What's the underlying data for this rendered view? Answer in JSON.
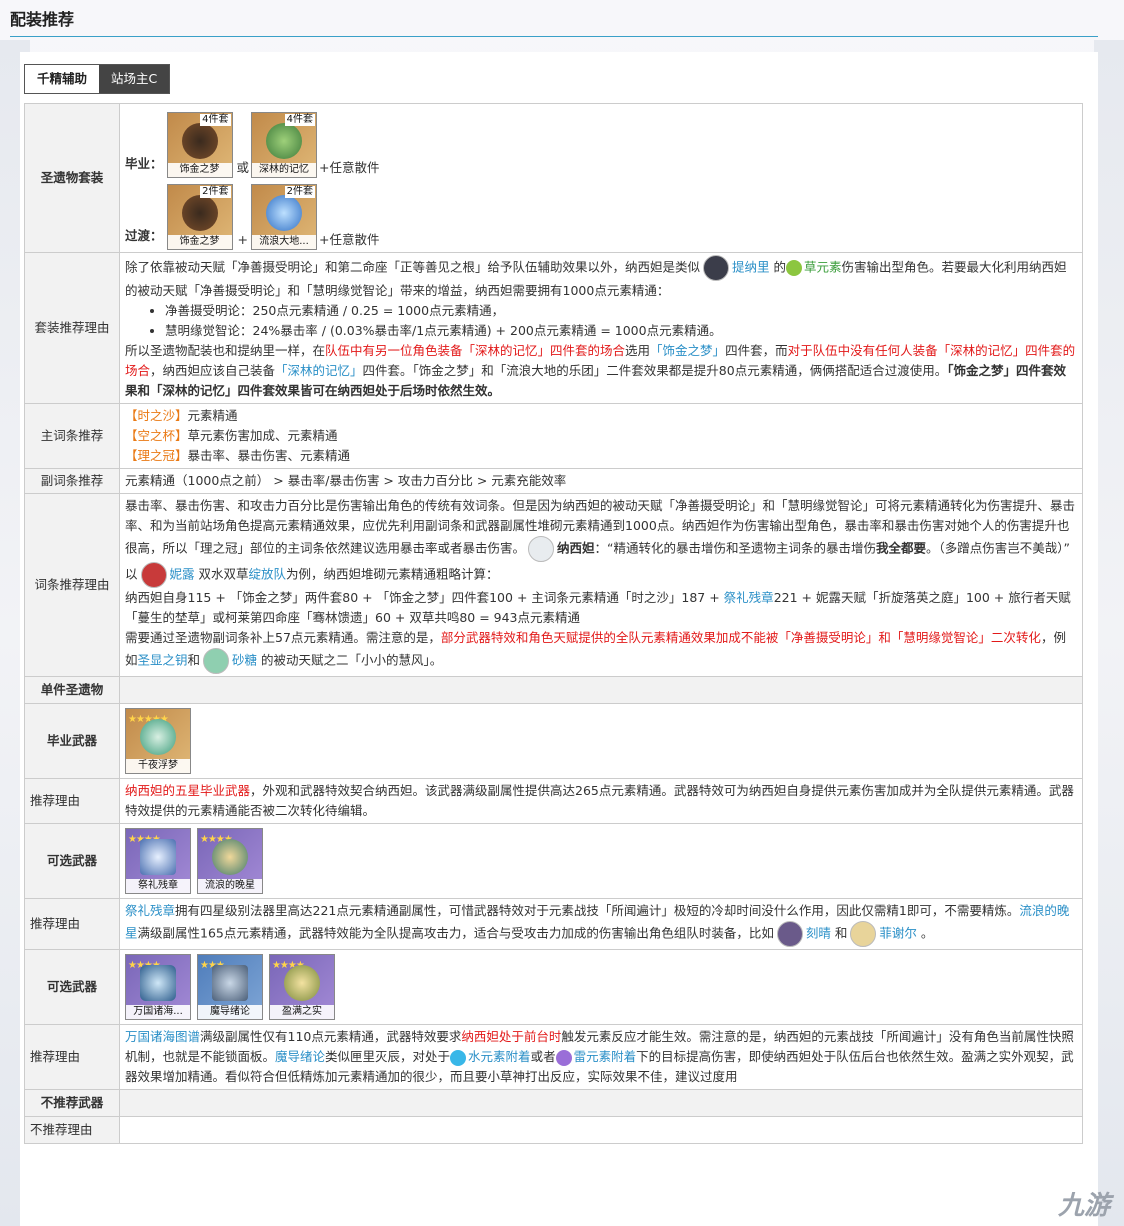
{
  "page": {
    "title": "配装推荐"
  },
  "tabs": [
    {
      "label": "千精辅助"
    },
    {
      "label": "站场主C"
    }
  ],
  "artifact_set": {
    "label": "圣遗物套装",
    "grad_label": "毕业：",
    "or": "或",
    "trans_label": "过渡：",
    "plus": "+",
    "any_tail": "+任意散件",
    "grad_items": [
      {
        "name": "饰金之梦",
        "pieces": "4件套"
      },
      {
        "name": "深林的记忆",
        "pieces": "4件套"
      }
    ],
    "trans_items": [
      {
        "name": "饰金之梦",
        "pieces": "2件套"
      },
      {
        "name": "流浪大地...",
        "pieces": "2件套"
      }
    ]
  },
  "set_reason": {
    "label": "套装推荐理由",
    "p1a": "除了依靠被动天赋「净善摄受明论」和第二命座「正等善见之根」给予队伍辅助效果以外，纳西妲是类似",
    "tighnari": "提纳里",
    "p1b": "的",
    "dendro": "草元素",
    "p1c": "伤害输出型角色。若要最大化利用纳西妲的被动天赋「净善摄受明论」和「慧明缘觉智论」带来的增益，纳西妲需要拥有1000点元素精通：",
    "b1": "净善摄受明论：250点元素精通 / 0.25 = 1000点元素精通，",
    "b2": "慧明缘觉智论：24%暴击率 / (0.03%暴击率/1点元素精通) + 200点元素精通 = 1000点元素精通。",
    "p2a": "所以圣遗物配装也和提纳里一样，在",
    "p2red1": "队伍中有另一位角色装备「深林的记忆」四件套的场合",
    "p2b": "选用",
    "p2blue1": "「饰金之梦」",
    "p2c": "四件套，而",
    "p2red2": "对于队伍中没有任何人装备「深林的记忆」四件套的场合",
    "p2d": "，纳西妲应该自己装备",
    "p2blue2": "「深林的记忆」",
    "p2e": "四件套。「饰金之梦」和「流浪大地的乐团」二件套效果都是提升80点元素精通，俩俩搭配适合过渡使用。",
    "p2bold": "「饰金之梦」四件套效果和「深林的记忆」四件套效果皆可在纳西妲处于后场时依然生效。"
  },
  "main_stat": {
    "label": "主词条推荐",
    "rows": [
      {
        "slot": "【时之沙】",
        "value": "元素精通"
      },
      {
        "slot": "【空之杯】",
        "value": "草元素伤害加成、元素精通"
      },
      {
        "slot": "【理之冠】",
        "value": "暴击率、暴击伤害、元素精通"
      }
    ]
  },
  "sub_stat": {
    "label": "副词条推荐",
    "value": "元素精通（1000点之前） > 暴击率/暴击伤害 > 攻击力百分比 > 元素充能效率"
  },
  "stat_reason": {
    "label": "词条推荐理由",
    "p1": "暴击率、暴击伤害、和攻击力百分比是伤害输出角色的传统有效词条。但是因为纳西妲的被动天赋「净善摄受明论」和「慧明缘觉智论」可将元素精通转化为伤害提升、暴击率、和为当前站场角色提高元素精通效果，应优先利用副词条和武器副属性堆砌元素精通到1000点。纳西妲作为伤害输出型角色，暴击率和暴击伤害对她个人的伤害提升也很高，所以「理之冠」部位的主词条依然建议选用暴击率或者暴击伤害。",
    "nahida": "纳西妲",
    "quote_a": "：“精通转化的暴击增伤和圣遗物主词条的暴击增伤",
    "quote_bold": "我全都要",
    "quote_b": "。（多蹭点伤害岂不美哉）”",
    "p2a": "以",
    "nilou": "妮露",
    "p2b": "双水双草",
    "bloom": "绽放队",
    "p2c": "为例，纳西妲堆砌元素精通粗略计算：",
    "p3a": "纳西妲自身115 + 「饰金之梦」两件套80 + 「饰金之梦」四件套100 + 主词条元素精通「时之沙」187 + ",
    "p3blue": "祭礼残章",
    "p3b": "221 + 妮露天赋「折旋落英之庭」100 + 旅行者天赋「蔓生的埜草」或柯莱第四命座「骞林馈遗」60 + 双草共鸣80 = 943点元素精通",
    "p4a": "需要通过圣遗物副词条补上57点元素精通。需注意的是，",
    "p4red": "部分武器特效和角色天赋提供的全队元素精通效果加成不能被「净善摄受明论」和「慧明缘觉智论」二次转化",
    "p4b": "，例如",
    "p4blue": "圣显之钥",
    "p4c": "和",
    "sucrose": "砂糖",
    "p4d": "的被动天赋之二「小小的慧风」。"
  },
  "single_artifact": {
    "label": "单件圣遗物"
  },
  "bis_weapon": {
    "label": "毕业武器",
    "items": [
      {
        "name": "千夜浮梦",
        "stars": "★★★★★"
      }
    ]
  },
  "bis_reason": {
    "label": "推荐理由",
    "red": "纳西妲的五星毕业武器",
    "text": "，外观和武器特效契合纳西妲。该武器满级副属性提供高达265点元素精通。武器特效可为纳西妲自身提供元素伤害加成并为全队提供元素精通。武器特效提供的元素精通能否被二次转化待编辑。"
  },
  "opt_weapon1": {
    "label": "可选武器",
    "items": [
      {
        "name": "祭礼残章",
        "stars": "★★★★"
      },
      {
        "name": "流浪的晚星",
        "stars": "★★★★"
      }
    ]
  },
  "opt_reason1": {
    "label": "推荐理由",
    "blue1": "祭礼残章",
    "t1": "拥有四星级别法器里高达221点元素精通副属性，可惜武器特效对于元素战技「所闻遍计」极短的冷却时间没什么作用，因此仅需精1即可，不需要精炼。",
    "blue2": "流浪的晚星",
    "t2": "满级副属性165点元素精通，武器特效能为全队提高攻击力，适合与受攻击力加成的伤害输出角色组队时装备，比如",
    "keqing": "刻晴",
    "and": "和",
    "fischl": "菲谢尔",
    "end": "。"
  },
  "opt_weapon2": {
    "label": "可选武器",
    "items": [
      {
        "name": "万国诸海...",
        "stars": "★★★★"
      },
      {
        "name": "魔导绪论",
        "stars": "★★★"
      },
      {
        "name": "盈满之实",
        "stars": "★★★★"
      }
    ]
  },
  "opt_reason2": {
    "label": "推荐理由",
    "blue1": "万国诸海图谱",
    "t1": "满级副属性仅有110点元素精通，武器特效要求",
    "red1": "纳西妲处于前台时",
    "t2": "触发元素反应才能生效。需注意的是，纳西妲的元素战技「所闻遍计」没有角色当前属性快照机制，也就是不能锁面板。",
    "blue2": "魔导绪论",
    "t3": "类似匣里灭辰，对处于",
    "hydro": "水元素附着",
    "t4": "或者",
    "electro": "雷元素附着",
    "t5": "下的目标提高伤害，即使纳西妲处于队伍后台也依然生效。盈满之实外观契，武器效果增加精通。看似符合但低精炼加元素精通加的很少，而且要小草神打出反应，实际效果不佳，建议过度用"
  },
  "not_rec": {
    "label": "不推荐武器"
  },
  "not_rec_reason": {
    "label": "不推荐理由"
  },
  "watermark": "九游",
  "colors": {
    "accent_line": "#3aa0c8",
    "red": "#e21919",
    "blue": "#2a8fc7",
    "orange": "#ea7a15"
  }
}
